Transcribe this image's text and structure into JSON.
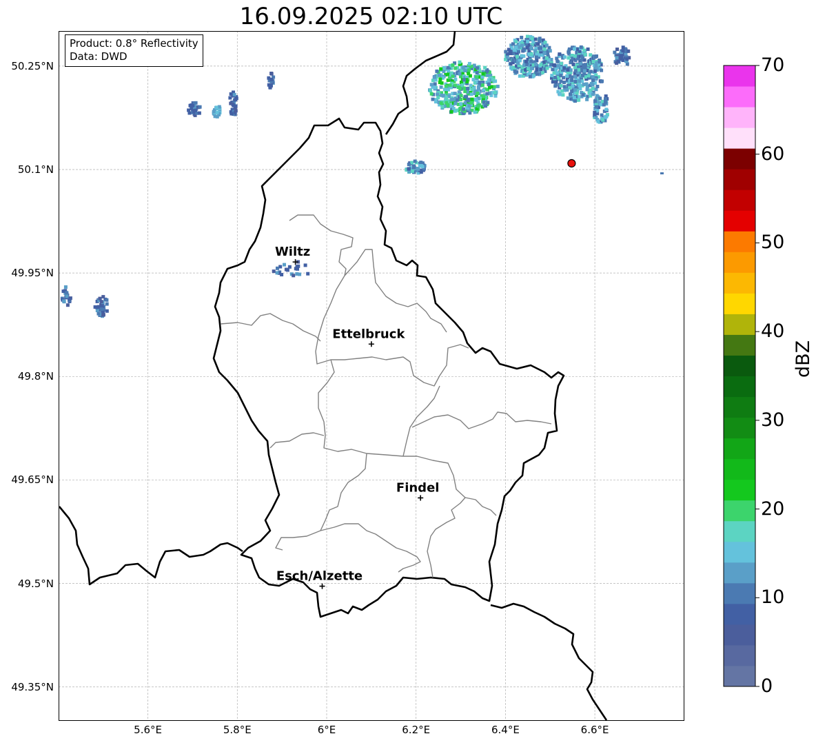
{
  "title": "16.09.2025 02:10 UTC",
  "info_box": {
    "product": "Product: 0.8° Reflectivity",
    "data": "Data: DWD"
  },
  "map": {
    "lon_range": [
      5.4,
      6.8
    ],
    "lat_range": [
      49.3,
      50.3
    ],
    "lat_ticks": [
      "50.25°N",
      "50.1°N",
      "49.95°N",
      "49.8°N",
      "49.65°N",
      "49.5°N",
      "49.35°N"
    ],
    "lon_ticks": [
      "5.6°E",
      "5.8°E",
      "6°E",
      "6.2°E",
      "6.4°E",
      "6.6°E"
    ],
    "gridlines": true,
    "cities": [
      {
        "name": "Wiltz",
        "lon": 5.93,
        "lat": 49.966
      },
      {
        "name": "Ettelbruck",
        "lon": 6.1,
        "lat": 49.847
      },
      {
        "name": "Findel",
        "lon": 6.21,
        "lat": 49.624
      },
      {
        "name": "Esch/Alzette",
        "lon": 5.99,
        "lat": 49.496
      }
    ],
    "radar_site": {
      "lon": 6.548,
      "lat": 50.109,
      "color": "#e8120c"
    }
  },
  "colorbar": {
    "label": "dBZ",
    "ticks": [
      "0",
      "10",
      "20",
      "30",
      "40",
      "50",
      "60",
      "70"
    ],
    "colors": [
      "#6475a4",
      "#5869a0",
      "#4b5e9c",
      "#4260a4",
      "#4b7ab2",
      "#5a9fc8",
      "#64c2dc",
      "#5cd4c2",
      "#3cd46c",
      "#14c81e",
      "#12b91a",
      "#12a617",
      "#128c14",
      "#0f7c12",
      "#0a6c10",
      "#0a5a0e",
      "#447812",
      "#b0b40a",
      "#ffd700",
      "#fcb802",
      "#fc9a00",
      "#fc7a00",
      "#e40000",
      "#c20000",
      "#a00000",
      "#7c0000",
      "#ffe0fa",
      "#ffb4fa",
      "#fc6cfa",
      "#ea34ec"
    ]
  }
}
